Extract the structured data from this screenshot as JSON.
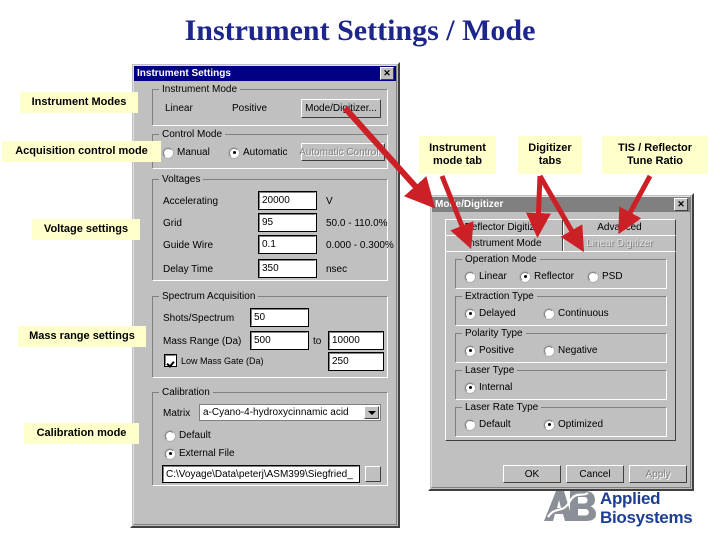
{
  "slide": {
    "title": "Instrument Settings / Mode"
  },
  "instrument_settings_dialog": {
    "title": "Instrument Settings",
    "close_label": "✕",
    "instrument_mode": {
      "group_label": "Instrument Mode",
      "mode_value": "Linear",
      "polarity_value": "Positive",
      "mode_digitizer_button": "Mode/Digitizer..."
    },
    "control_mode": {
      "group_label": "Control Mode",
      "manual_label": "Manual",
      "automatic_label": "Automatic",
      "selected": "Automatic",
      "automatic_control_button": "Automatic Control..."
    },
    "voltages": {
      "group_label": "Voltages",
      "rows": [
        {
          "label": "Accelerating",
          "value": "20000",
          "unit": "V"
        },
        {
          "label": "Grid",
          "value": "95",
          "unit": "50.0 - 110.0%"
        },
        {
          "label": "Guide Wire",
          "value": "0.1",
          "unit": "0.000 - 0.300%"
        },
        {
          "label": "Delay Time",
          "value": "350",
          "unit": "nsec"
        }
      ]
    },
    "spectrum_acquisition": {
      "group_label": "Spectrum Acquisition",
      "shots_label": "Shots/Spectrum",
      "shots_value": "50",
      "mass_range_label": "Mass Range (Da)",
      "mass_range_from": "500",
      "mass_range_to_label": "to",
      "mass_range_to": "10000",
      "low_mass_gate_label": "Low Mass Gate (Da)",
      "low_mass_gate_checked": true,
      "low_mass_gate_value": "250"
    },
    "calibration": {
      "group_label": "Calibration",
      "matrix_label": "Matrix",
      "matrix_value": "a-Cyano-4-hydroxycinnamic acid",
      "default_label": "Default",
      "external_file_label": "External File",
      "selected": "External File",
      "path_value": "C:\\Voyage\\Data\\peterj\\ASM399\\Siegfried_",
      "browse_label": ""
    }
  },
  "mode_digitizer_dialog": {
    "title": "Mode/Digitizer",
    "close_label": "✕",
    "tabs_row1": [
      {
        "label": "Reflector Digitizer",
        "state": "normal"
      },
      {
        "label": "Advanced",
        "state": "normal"
      }
    ],
    "tabs_row2": [
      {
        "label": "Instrument Mode",
        "state": "active"
      },
      {
        "label": "Linear Digitizer",
        "state": "dim"
      }
    ],
    "operation_mode": {
      "group_label": "Operation Mode",
      "options": [
        "Linear",
        "Reflector",
        "PSD"
      ],
      "selected": "Reflector"
    },
    "extraction_type": {
      "group_label": "Extraction Type",
      "options": [
        "Delayed",
        "Continuous"
      ],
      "selected": "Delayed"
    },
    "polarity_type": {
      "group_label": "Polarity Type",
      "options": [
        "Positive",
        "Negative"
      ],
      "selected": "Positive"
    },
    "laser_type": {
      "group_label": "Laser Type",
      "options": [
        "Internal"
      ],
      "selected": "Internal"
    },
    "laser_rate_type": {
      "group_label": "Laser Rate Type",
      "options": [
        "Default",
        "Optimized"
      ],
      "selected": "Optimized"
    },
    "buttons": {
      "ok": "OK",
      "cancel": "Cancel",
      "apply": "Apply"
    }
  },
  "callouts": {
    "instrument_modes": "Instrument Modes",
    "acquisition_control_mode": "Acquisition control mode",
    "voltage_settings": "Voltage settings",
    "mass_range_settings": "Mass range settings",
    "calibration_mode": "Calibration mode",
    "instrument_mode_tab": "Instrument\nmode tab",
    "instrument_mode_tab_l1": "Instrument",
    "instrument_mode_tab_l2": "mode tab",
    "digitizer_tabs_l1": "Digitizer",
    "digitizer_tabs_l2": "tabs",
    "tis_reflector_l1": "TIS / Reflector",
    "tis_reflector_l2": "Tune Ratio"
  },
  "logo": {
    "mark": "AB",
    "line1": "Applied",
    "line2": "Biosystems"
  },
  "colors": {
    "title_blue": "#1c268c",
    "callout_yellow": "#ffffcc",
    "arrow_red": "#cc2026",
    "dialog_gray": "#c0c0c0",
    "titlebar_blue": "#000080",
    "logo_blue": "#1c3f94"
  }
}
